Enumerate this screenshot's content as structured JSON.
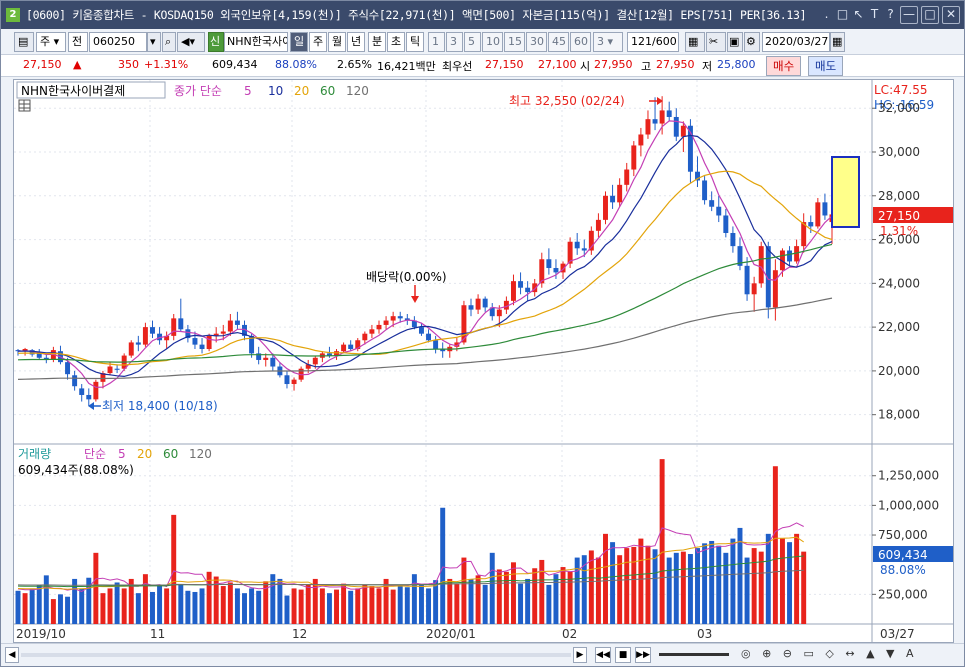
{
  "titlebar": {
    "badge": "2",
    "text": "[0600] 키움종합차트 - KOSDAQ150 외국인보유[4,159(천)] 주식수[22,971(천)] 액면[500] 자본금[115(억)] 결산[12월] EPS[751] PER[36.13]",
    "btn_restore": ".",
    "btn_minimize": "□",
    "btn_arrows": "↖",
    "btn_T": "T",
    "btn_help": "?",
    "btn_min": "—",
    "btn_max": "□",
    "btn_close": "✕"
  },
  "toolbar": {
    "market": "주",
    "prev": "전",
    "code": "060250",
    "stock_name": "NHN한국사이",
    "new_badge": "신",
    "periods": [
      "일",
      "주",
      "월",
      "년",
      "분",
      "초",
      "틱"
    ],
    "intervals": [
      "1",
      "3",
      "5",
      "10",
      "15",
      "30",
      "45",
      "60"
    ],
    "interval_select": "3",
    "count": "121/600",
    "date": "2020/03/27"
  },
  "quote": {
    "price": "27,150",
    "arrow": "▲",
    "change": "350",
    "change_pct": "+1.31%",
    "volume": "609,434",
    "vol_ratio": "88.08%",
    "turnover": "2.65%",
    "amount": "16,421백만",
    "best_label": "최우선",
    "ask": "27,150",
    "bid": "27,100",
    "open_label": "시",
    "open": "27,950",
    "high_label": "고",
    "high": "27,950",
    "low_label": "저",
    "low": "25,800",
    "buy_button": "매수",
    "sell_button": "매도"
  },
  "price_panel": {
    "legend_name": "NHN한국사이버결제",
    "legend_ma_label": "종가 단순",
    "legend_ma": [
      "5",
      "10",
      "20",
      "60",
      "120"
    ],
    "lc_label": "LC:47.55",
    "hc_label": "HC:-16.59",
    "high_note": "최고 32,550 (02/24)",
    "low_note": "최저 18,400 (10/18)",
    "dividend_note": "배당락(0.00%)",
    "current_price_tag": "27,150",
    "current_pct_tag": "1.31%",
    "yticks": [
      "32,000",
      "30,000",
      "28,000",
      "26,000",
      "24,000",
      "22,000",
      "20,000",
      "18,000"
    ]
  },
  "volume_panel": {
    "legend_label": "거래량",
    "legend_ma_label": "단순",
    "legend_ma": [
      "5",
      "20",
      "60",
      "120"
    ],
    "current_volume": "609,434주(88.08%)",
    "tag_volume": "609,434",
    "tag_pct": "88.08%",
    "yticks": [
      "1,250,000",
      "1,000,000",
      "750,000",
      "250,000"
    ]
  },
  "xaxis": {
    "labels": [
      "2019/10",
      "11",
      "12",
      "2020/01",
      "02",
      "03",
      "03/27"
    ]
  },
  "colors": {
    "up": "#e8231c",
    "down": "#1f5fc8",
    "ma5": "#c43fb5",
    "ma10": "#1a2f9c",
    "ma20": "#e3a40a",
    "ma60": "#2e8b3a",
    "ma120": "#707070",
    "title_bg": "#3a4a6b"
  },
  "chart_data": {
    "type": "candlestick",
    "title": "NHN한국사이버결제",
    "x_range": [
      "2019/10",
      "2020/03/27"
    ],
    "ylim": [
      17000,
      33000
    ],
    "volume_ylim": [
      0,
      1450000
    ],
    "candles": [
      [
        20950,
        21000,
        20700,
        20900
      ],
      [
        20900,
        21050,
        20700,
        21000
      ],
      [
        20950,
        21000,
        20650,
        20750
      ],
      [
        20800,
        21000,
        20500,
        20600
      ],
      [
        20600,
        20800,
        20350,
        20500
      ],
      [
        20500,
        21100,
        20400,
        20950
      ],
      [
        20900,
        21150,
        20300,
        20400
      ],
      [
        20400,
        20600,
        19600,
        19850
      ],
      [
        19800,
        20000,
        19100,
        19300
      ],
      [
        19200,
        19400,
        18600,
        18900
      ],
      [
        18900,
        19200,
        18400,
        18700
      ],
      [
        18700,
        19600,
        18600,
        19500
      ],
      [
        19500,
        20000,
        19200,
        19900
      ],
      [
        19900,
        20400,
        19800,
        20200
      ],
      [
        20100,
        20300,
        19900,
        20050
      ],
      [
        20100,
        20800,
        20000,
        20700
      ],
      [
        20700,
        21400,
        20600,
        21300
      ],
      [
        21300,
        21600,
        20900,
        21200
      ],
      [
        21200,
        22200,
        21100,
        22000
      ],
      [
        22000,
        22300,
        21500,
        21700
      ],
      [
        21700,
        22000,
        21200,
        21400
      ],
      [
        21400,
        21800,
        21000,
        21600
      ],
      [
        21600,
        22600,
        21400,
        22400
      ],
      [
        22400,
        23300,
        21800,
        21900
      ],
      [
        21900,
        22100,
        21300,
        21500
      ],
      [
        21500,
        21800,
        21000,
        21200
      ],
      [
        21200,
        21500,
        20800,
        21000
      ],
      [
        21000,
        21700,
        20900,
        21600
      ],
      [
        21600,
        22000,
        21300,
        21700
      ],
      [
        21700,
        22100,
        21400,
        21800
      ],
      [
        21800,
        22600,
        21600,
        22300
      ],
      [
        22300,
        22700,
        21900,
        22100
      ],
      [
        22100,
        22300,
        21400,
        21600
      ],
      [
        21600,
        21700,
        20600,
        20800
      ],
      [
        20800,
        21100,
        20300,
        20500
      ],
      [
        20500,
        20800,
        20200,
        20600
      ],
      [
        20600,
        20800,
        20000,
        20200
      ],
      [
        20200,
        20400,
        19700,
        19800
      ],
      [
        19800,
        20000,
        19200,
        19400
      ],
      [
        19400,
        19700,
        19100,
        19600
      ],
      [
        19600,
        20200,
        19500,
        20100
      ],
      [
        20100,
        20500,
        19900,
        20300
      ],
      [
        20300,
        20700,
        20100,
        20600
      ],
      [
        20600,
        20900,
        20400,
        20800
      ],
      [
        20800,
        21100,
        20600,
        20700
      ],
      [
        20700,
        21000,
        20500,
        20900
      ],
      [
        20900,
        21300,
        20800,
        21200
      ],
      [
        21200,
        21400,
        20900,
        21000
      ],
      [
        21000,
        21500,
        20900,
        21400
      ],
      [
        21400,
        21800,
        21200,
        21700
      ],
      [
        21700,
        22100,
        21500,
        21900
      ],
      [
        21900,
        22300,
        21700,
        22100
      ],
      [
        22100,
        22500,
        21900,
        22300
      ],
      [
        22300,
        22700,
        22000,
        22500
      ],
      [
        22500,
        22700,
        22200,
        22400
      ],
      [
        22400,
        22600,
        22100,
        22300
      ],
      [
        22300,
        22500,
        21900,
        22000
      ],
      [
        22000,
        22200,
        21600,
        21700
      ],
      [
        21700,
        21900,
        21300,
        21400
      ],
      [
        21400,
        21600,
        20800,
        21000
      ],
      [
        21000,
        21300,
        20600,
        20900
      ],
      [
        20900,
        21200,
        20600,
        21100
      ],
      [
        21100,
        21500,
        20900,
        21300
      ],
      [
        21300,
        23200,
        21200,
        23000
      ],
      [
        23000,
        23300,
        22500,
        22800
      ],
      [
        22800,
        23500,
        22600,
        23300
      ],
      [
        23300,
        23400,
        22700,
        22900
      ],
      [
        22900,
        23100,
        22300,
        22500
      ],
      [
        22500,
        23000,
        22000,
        22800
      ],
      [
        22800,
        23400,
        22600,
        23200
      ],
      [
        23200,
        24400,
        23000,
        24100
      ],
      [
        24100,
        24500,
        23500,
        23800
      ],
      [
        23800,
        24100,
        23200,
        23600
      ],
      [
        23600,
        24200,
        23400,
        24000
      ],
      [
        24000,
        25400,
        23800,
        25100
      ],
      [
        25100,
        25600,
        24400,
        24700
      ],
      [
        24700,
        25100,
        24200,
        24500
      ],
      [
        24500,
        25000,
        24200,
        24900
      ],
      [
        24900,
        26100,
        24700,
        25900
      ],
      [
        25900,
        26300,
        25300,
        25600
      ],
      [
        25600,
        26000,
        25200,
        25500
      ],
      [
        25500,
        26600,
        25300,
        26400
      ],
      [
        26400,
        27200,
        26100,
        26900
      ],
      [
        26900,
        28200,
        26700,
        28000
      ],
      [
        28000,
        28500,
        27400,
        27700
      ],
      [
        27700,
        28800,
        27500,
        28500
      ],
      [
        28500,
        29500,
        28200,
        29200
      ],
      [
        29200,
        30500,
        28900,
        30300
      ],
      [
        30300,
        31100,
        29800,
        30800
      ],
      [
        30800,
        31900,
        30600,
        31500
      ],
      [
        31500,
        32500,
        31000,
        31300
      ],
      [
        31300,
        32550,
        30800,
        31900
      ],
      [
        31900,
        32300,
        31400,
        31600
      ],
      [
        31600,
        32000,
        30500,
        30700
      ],
      [
        30700,
        31400,
        30000,
        31200
      ],
      [
        31200,
        31500,
        28600,
        29100
      ],
      [
        29100,
        29800,
        28400,
        28700
      ],
      [
        28700,
        28900,
        27600,
        27800
      ],
      [
        27800,
        28200,
        27300,
        27500
      ],
      [
        27500,
        28000,
        26800,
        27100
      ],
      [
        27100,
        27400,
        26100,
        26300
      ],
      [
        26300,
        26600,
        25400,
        25700
      ],
      [
        25700,
        26100,
        24600,
        24800
      ],
      [
        24800,
        25200,
        23200,
        23500
      ],
      [
        23500,
        24300,
        22700,
        24000
      ],
      [
        24000,
        25900,
        23800,
        25700
      ],
      [
        25700,
        25900,
        22400,
        22900
      ],
      [
        22900,
        25100,
        22300,
        24600
      ],
      [
        24600,
        25600,
        24300,
        25500
      ],
      [
        25500,
        25700,
        24800,
        25000
      ],
      [
        25000,
        26000,
        24900,
        25700
      ],
      [
        25700,
        27200,
        25400,
        26800
      ],
      [
        26800,
        27100,
        26300,
        26600
      ],
      [
        26600,
        27900,
        26500,
        27700
      ],
      [
        27700,
        28100,
        26900,
        27100
      ],
      [
        26800,
        27950,
        25800,
        27150
      ]
    ],
    "volumes": [
      280000,
      260000,
      300000,
      330000,
      410000,
      210000,
      250000,
      230000,
      380000,
      300000,
      390000,
      600000,
      260000,
      300000,
      350000,
      300000,
      380000,
      260000,
      420000,
      270000,
      330000,
      300000,
      920000,
      330000,
      280000,
      270000,
      300000,
      440000,
      400000,
      320000,
      350000,
      300000,
      260000,
      300000,
      280000,
      360000,
      420000,
      380000,
      240000,
      300000,
      290000,
      330000,
      380000,
      300000,
      260000,
      290000,
      340000,
      280000,
      300000,
      330000,
      320000,
      300000,
      380000,
      290000,
      330000,
      310000,
      420000,
      330000,
      300000,
      370000,
      980000,
      380000,
      340000,
      560000,
      380000,
      410000,
      330000,
      600000,
      460000,
      440000,
      520000,
      340000,
      380000,
      470000,
      540000,
      330000,
      420000,
      480000,
      440000,
      560000,
      580000,
      620000,
      560000,
      760000,
      690000,
      580000,
      640000,
      650000,
      720000,
      660000,
      630000,
      1390000,
      560000,
      600000,
      610000,
      590000,
      640000,
      680000,
      700000,
      660000,
      600000,
      720000,
      810000,
      560000,
      640000,
      610000,
      760000,
      1330000,
      720000,
      690000,
      760000,
      610000
    ],
    "series": [
      {
        "name": "5"
      },
      {
        "name": "10"
      },
      {
        "name": "20"
      },
      {
        "name": "60"
      },
      {
        "name": "120"
      }
    ]
  }
}
